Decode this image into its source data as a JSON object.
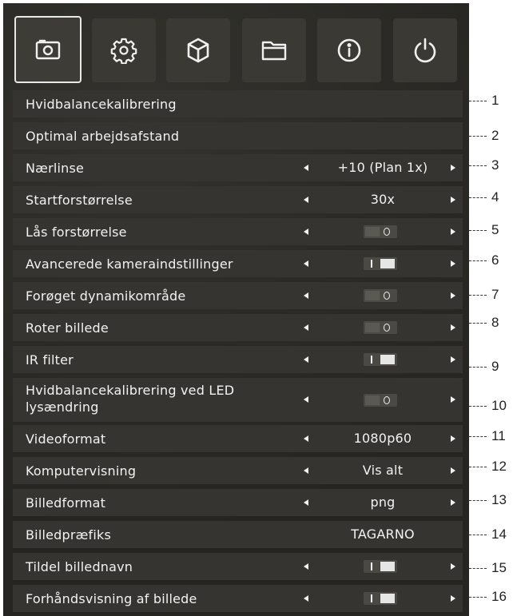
{
  "tabs": [
    {
      "icon": "camera-icon",
      "active": true
    },
    {
      "icon": "gear-icon",
      "active": false
    },
    {
      "icon": "cube-icon",
      "active": false
    },
    {
      "icon": "folder-icon",
      "active": false
    },
    {
      "icon": "info-icon",
      "active": false
    },
    {
      "icon": "power-icon",
      "active": false
    }
  ],
  "rows": [
    {
      "label": "Hvidbalancekalibrering",
      "type": "action",
      "callout": "1"
    },
    {
      "label": "Optimal arbejdsafstand",
      "type": "action",
      "callout": "2"
    },
    {
      "label": "Nærlinse",
      "type": "select",
      "value": "+10 (Plan 1x)",
      "callout": "3"
    },
    {
      "label": "Startforstørrelse",
      "type": "select",
      "value": "30x",
      "callout": "4"
    },
    {
      "label": "Lås forstørrelse",
      "type": "toggle",
      "state": "off",
      "callout": "5"
    },
    {
      "label": "Avancerede kameraindstillinger",
      "type": "toggle",
      "state": "on",
      "callout": "6"
    },
    {
      "label": "Forøget dynamikområde",
      "type": "toggle",
      "state": "off",
      "callout": "7"
    },
    {
      "label": "Roter billede",
      "type": "toggle",
      "state": "off",
      "callout": "8"
    },
    {
      "label": "IR filter",
      "type": "toggle",
      "state": "on",
      "callout": "9"
    },
    {
      "label": "Hvidbalancekalibrering ved LED lysændring",
      "type": "toggle",
      "state": "off",
      "callout": "10"
    },
    {
      "label": "Videoformat",
      "type": "select",
      "value": "1080p60",
      "callout": "11"
    },
    {
      "label": "Komputervisning",
      "type": "select",
      "value": "Vis alt",
      "callout": "12"
    },
    {
      "label": "Billedformat",
      "type": "select",
      "value": "png",
      "callout": "13"
    },
    {
      "label": "Billedpræfiks",
      "type": "text",
      "value": "TAGARNO",
      "callout": "14"
    },
    {
      "label": "Tildel billednavn",
      "type": "toggle",
      "state": "on",
      "callout": "15"
    },
    {
      "label": "Forhåndsvisning af billede",
      "type": "toggle",
      "state": "on",
      "callout": "16"
    }
  ]
}
